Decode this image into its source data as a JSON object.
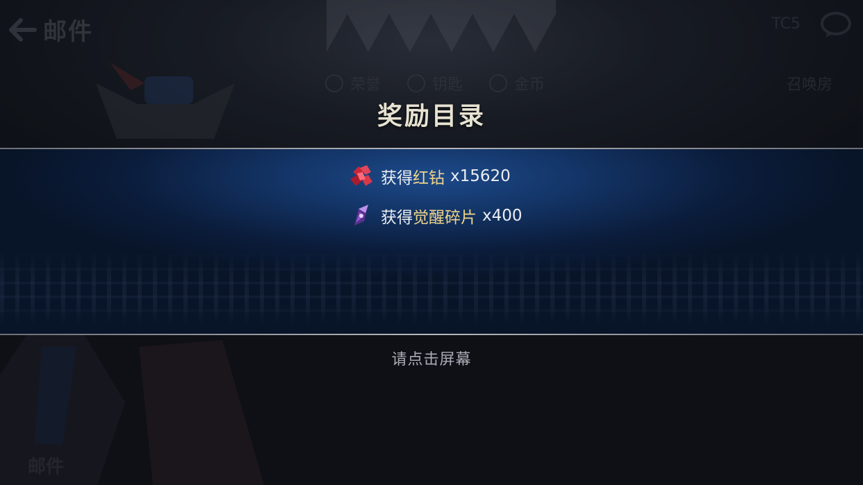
{
  "background": {
    "back_icon": "back-arrow-icon",
    "screen_title": "邮件",
    "tabs": [
      "荣誉",
      "钥匙",
      "金币"
    ],
    "right_tab": "召唤房",
    "currency_text": "TC5",
    "chat_icon": "chat-bubble-icon",
    "bottom_label": "邮件"
  },
  "modal": {
    "title": "奖励目录",
    "rewards": [
      {
        "icon": "red-diamond-icon",
        "prefix": "获得",
        "item": "红钻",
        "quantity": "x15620",
        "item_color": "#f0d48a"
      },
      {
        "icon": "awakening-shard-icon",
        "prefix": "获得",
        "item": "觉醒碎片",
        "quantity": "x400",
        "item_color": "#f0d48a"
      }
    ],
    "tap_hint": "请点击屏幕"
  },
  "colors": {
    "band_blue": "#133466",
    "title_text": "#e8e2d2",
    "item_gold": "#f0d48a",
    "hint_gray": "#a9acb4"
  }
}
